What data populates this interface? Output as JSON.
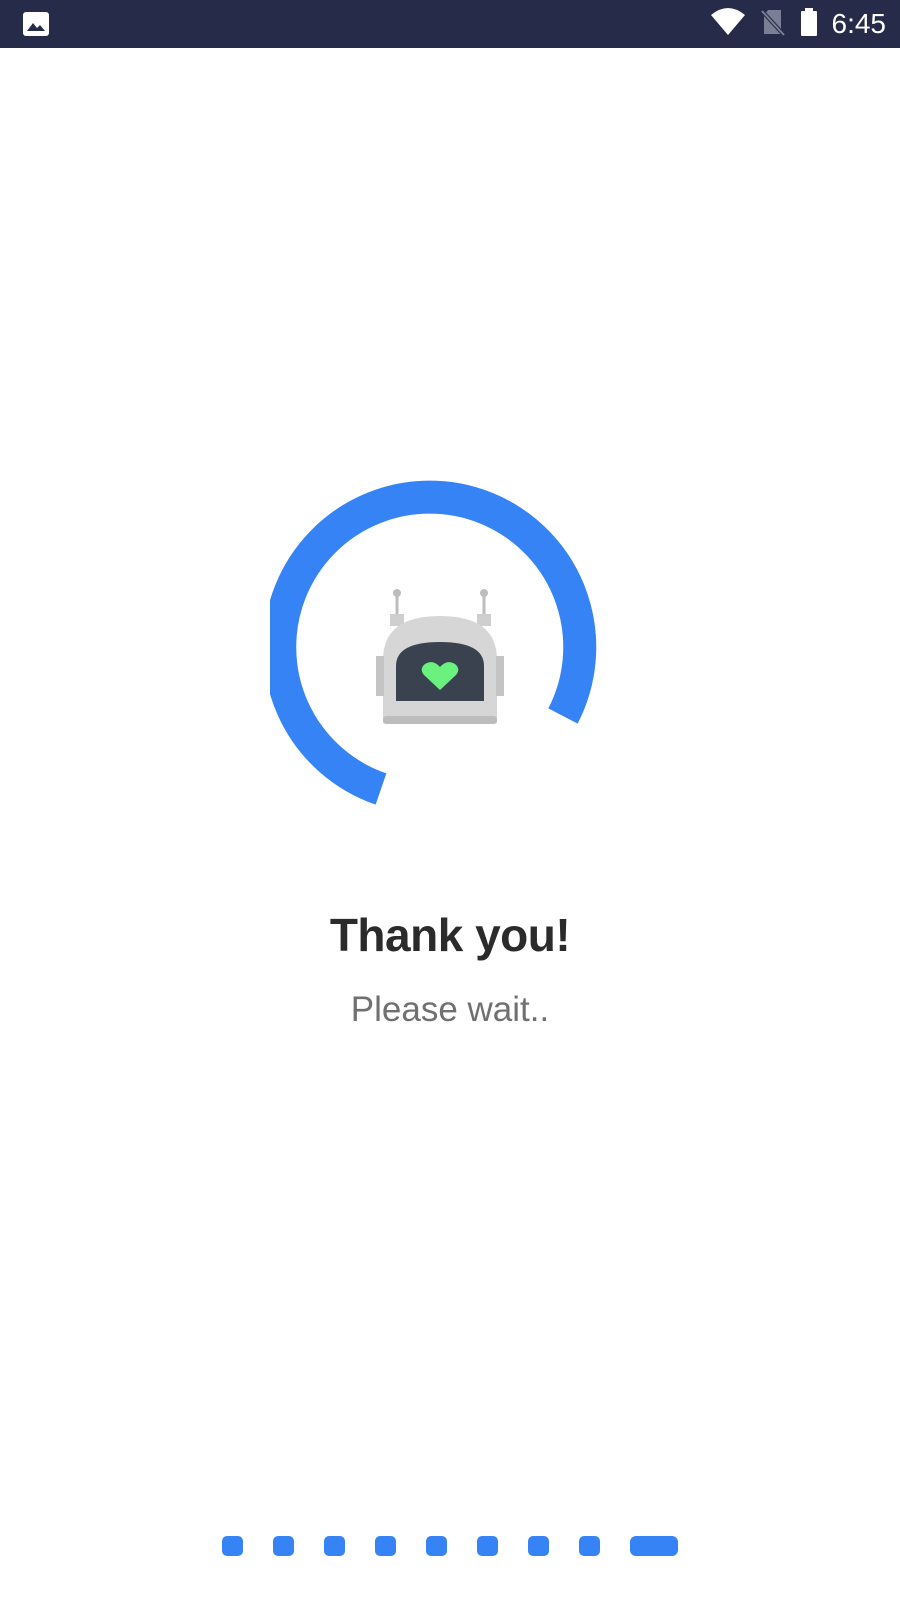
{
  "status_bar": {
    "time": "6:45",
    "left_icon": "image-icon",
    "icons": [
      "wifi-icon",
      "no-sim-icon",
      "battery-icon"
    ]
  },
  "main": {
    "title": "Thank you!",
    "subtitle": "Please wait..",
    "illustration": "robot-heart-icon"
  },
  "pager": {
    "total": 9,
    "active_index": 8
  },
  "colors": {
    "status_bar": "#252b48",
    "accent": "#3683f6",
    "heart": "#6bf27e"
  }
}
